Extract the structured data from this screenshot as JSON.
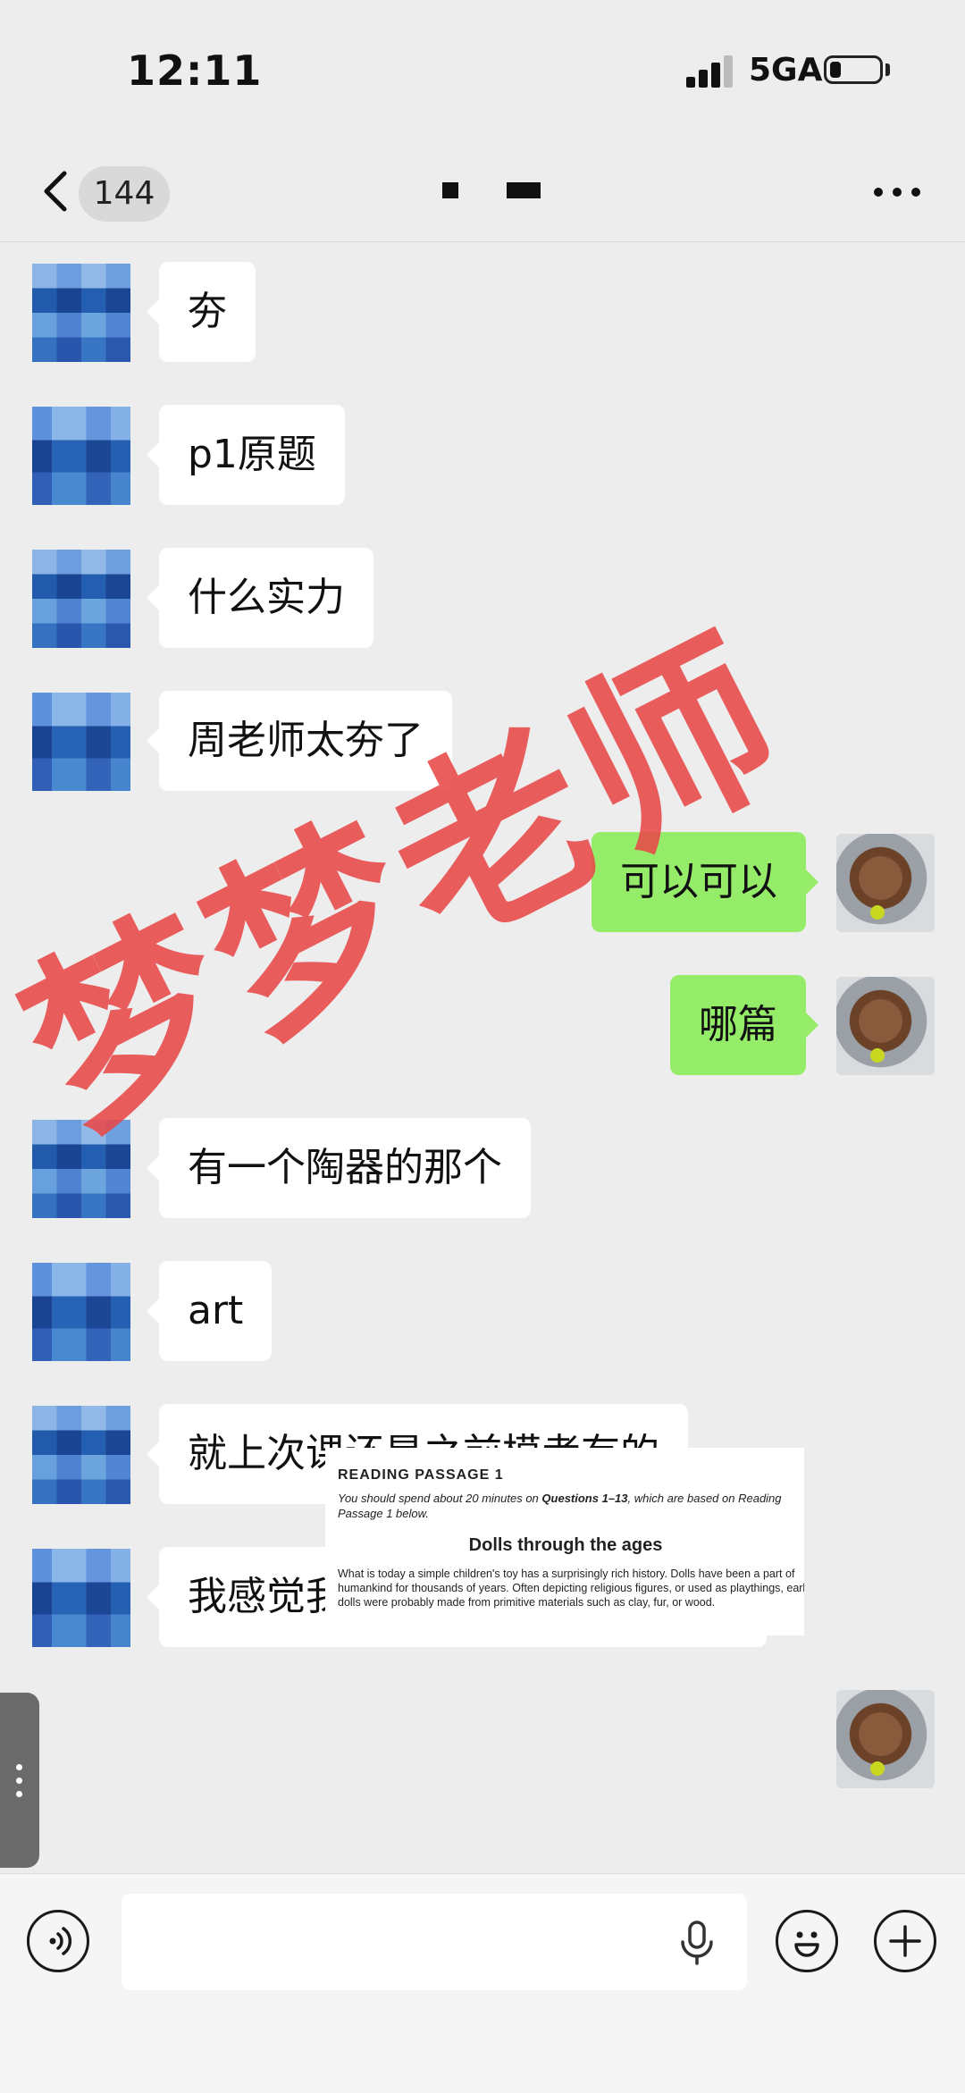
{
  "status_bar": {
    "time": "12:11",
    "network": "5GA"
  },
  "nav": {
    "unread_count": "144"
  },
  "messages": [
    {
      "side": "left",
      "text": "夯"
    },
    {
      "side": "left",
      "text": "p1原题"
    },
    {
      "side": "left",
      "text": "什么实力"
    },
    {
      "side": "left",
      "text": "周老师太夯了"
    },
    {
      "side": "right",
      "text": "可以可以"
    },
    {
      "side": "right",
      "text": "哪篇"
    },
    {
      "side": "left",
      "text": "有一个陶器的那个"
    },
    {
      "side": "left",
      "text": "art"
    },
    {
      "side": "left",
      "text": "就上次课还是之前模考有的"
    },
    {
      "side": "left",
      "text": "我感觉我阅读这次比之前好多了"
    }
  ],
  "document_card": {
    "heading": "READING PASSAGE 1",
    "instruction_pre": "You should spend about 20 minutes on ",
    "instruction_bold": "Questions 1–13",
    "instruction_post": ", which are based on Reading Passage 1 below.",
    "title": "Dolls through the ages",
    "body": "What is today a simple children's toy has a surprisingly rich history. Dolls have been a part of humankind for thousands of years. Often depicting religious figures, or used as playthings, early dolls were probably made from primitive materials such as clay, fur, or wood."
  },
  "watermark": "梦梦老师",
  "colors": {
    "sent_bubble": "#95ec69",
    "received_bubble": "#ffffff",
    "background": "#ededed",
    "watermark": "#e84848"
  }
}
